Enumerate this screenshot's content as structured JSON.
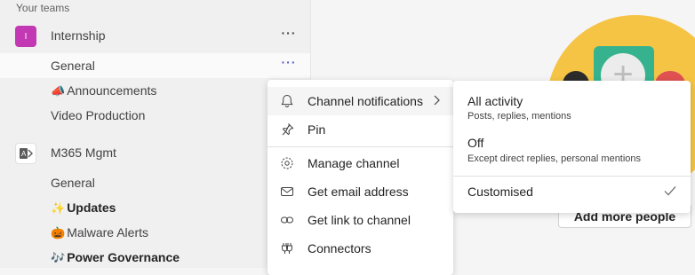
{
  "sidebar": {
    "section_header": "Your teams",
    "teams": [
      {
        "avatar_letter": "I",
        "avatar_color": "#c239b3",
        "name": "Internship",
        "channels": [
          {
            "label": "General",
            "selected": true
          },
          {
            "label": "Announcements",
            "emoji": "📣"
          },
          {
            "label": "Video Production"
          }
        ]
      },
      {
        "avatar_icon": "exchange-logo-icon",
        "name": "M365 Mgmt",
        "channels": [
          {
            "label": "General"
          },
          {
            "label": "Updates",
            "emoji": "✨",
            "bold": true
          },
          {
            "label": "Malware Alerts",
            "emoji": "🎃"
          },
          {
            "label": "Power Governance",
            "emoji": "🎶",
            "bold": true
          }
        ]
      }
    ],
    "more_label": "···"
  },
  "main": {
    "add_people_label": "Add more people"
  },
  "context_menu": {
    "items": [
      {
        "label": "Channel notifications",
        "icon": "bell-icon",
        "has_submenu": true
      },
      {
        "label": "Pin",
        "icon": "pin-icon"
      },
      {
        "label": "Manage channel",
        "icon": "gear-icon"
      },
      {
        "label": "Get email address",
        "icon": "mail-icon"
      },
      {
        "label": "Get link to channel",
        "icon": "link-icon"
      },
      {
        "label": "Connectors",
        "icon": "connectors-icon"
      }
    ]
  },
  "notifications_submenu": {
    "options": [
      {
        "title": "All activity",
        "desc": "Posts, replies, mentions"
      },
      {
        "title": "Off",
        "desc": "Except direct replies, personal mentions"
      },
      {
        "title": "Customised",
        "selected": true
      }
    ]
  },
  "colors": {
    "accent": "#5b5fc7",
    "illustration_yellow": "#f6c445",
    "illustration_green": "#36b38e"
  }
}
